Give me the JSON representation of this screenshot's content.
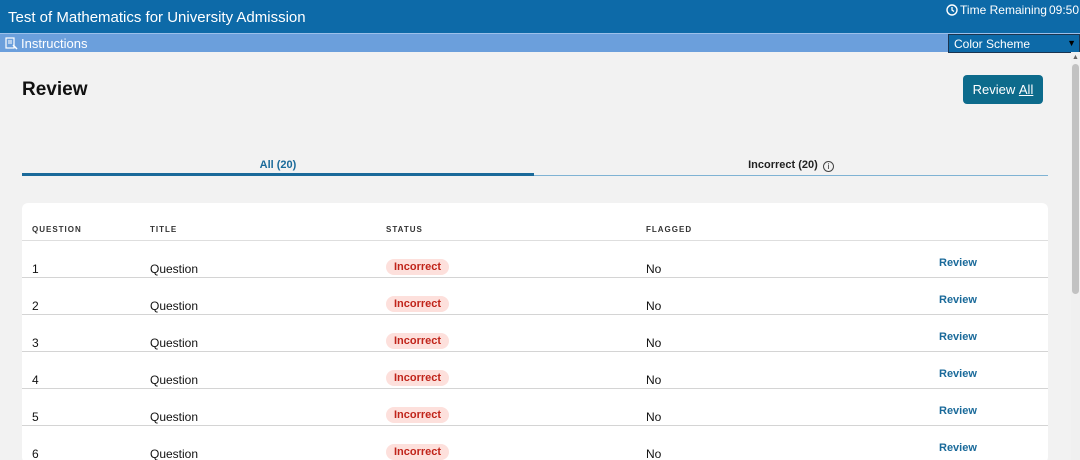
{
  "header": {
    "app_title": "Test of Mathematics for University Admission",
    "timer_label": "Time Remaining",
    "timer_value": "09:50"
  },
  "menubar": {
    "instructions_label": "Instructions",
    "color_scheme_label": "Color Scheme"
  },
  "main": {
    "page_title": "Review",
    "review_all_prefix": "Review ",
    "review_all_underlined": "All",
    "tabs": [
      {
        "label": "All (20)",
        "active": true
      },
      {
        "label": "Incorrect (20)",
        "active": false
      }
    ],
    "table": {
      "columns": [
        "QUESTION",
        "TITLE",
        "STATUS",
        "FLAGGED"
      ],
      "rows": [
        {
          "question": "1",
          "title": "Question",
          "status": "Incorrect",
          "flagged": "No",
          "action": "Review"
        },
        {
          "question": "2",
          "title": "Question",
          "status": "Incorrect",
          "flagged": "No",
          "action": "Review"
        },
        {
          "question": "3",
          "title": "Question",
          "status": "Incorrect",
          "flagged": "No",
          "action": "Review"
        },
        {
          "question": "4",
          "title": "Question",
          "status": "Incorrect",
          "flagged": "No",
          "action": "Review"
        },
        {
          "question": "5",
          "title": "Question",
          "status": "Incorrect",
          "flagged": "No",
          "action": "Review"
        },
        {
          "question": "6",
          "title": "Question",
          "status": "Incorrect",
          "flagged": "No",
          "action": "Review"
        }
      ]
    }
  },
  "icons": {
    "timer": "clock-icon",
    "instructions": "instructions-icon",
    "dropdown": "caret-down-icon",
    "info": "info-icon"
  },
  "colors": {
    "header_bg": "#0d6aa8",
    "menubar_bg": "#6b9fdc",
    "accent": "#1a6a9a",
    "incorrect_text": "#c0241a",
    "incorrect_bg": "#fde0dc"
  }
}
